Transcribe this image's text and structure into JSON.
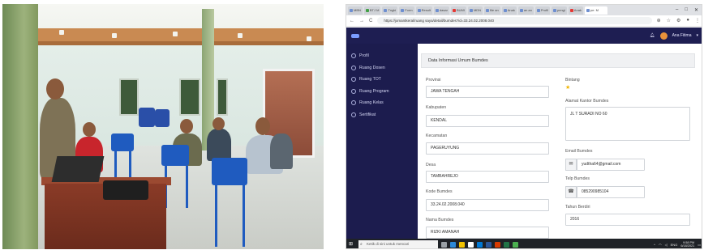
{
  "colors": {
    "navbar": "#1e1e52",
    "sidebar": "#1c1c4e",
    "star": "#f0b400",
    "taskbar": "#1f2227"
  },
  "browser": {
    "tabs": [
      "MBN",
      "BTJ M",
      "Tngki",
      "Form",
      "Result",
      "dasar",
      "BUMI",
      "MDN",
      "file an",
      "Anak",
      "an an",
      "Profil",
      "pengi",
      "Anak",
      "pe: M"
    ],
    "url": "https://jomantkeral/ruang saya/detail/bumdes?id=33.24.02.2008.040",
    "nav_back": "←",
    "nav_forward": "→",
    "nav_reload": "C",
    "win_min": "–",
    "win_max": "□",
    "win_close": "✕"
  },
  "app": {
    "user_name": "Ana Fitima",
    "sidebar": [
      {
        "label": "Profil",
        "icon": "user-icon"
      },
      {
        "label": "Ruang Dosen",
        "icon": "globe-icon"
      },
      {
        "label": "Ruang TOT",
        "icon": "globe-icon"
      },
      {
        "label": "Ruang Program",
        "icon": "globe-icon"
      },
      {
        "label": "Ruang Kelas",
        "icon": "globe-icon"
      },
      {
        "label": "Sertifikat",
        "icon": "users-icon"
      }
    ],
    "card_title": "Data Informasi Umum Bumdes",
    "fields": {
      "provinsi_label": "Provinsi",
      "provinsi_value": "JAWA TENGAH",
      "kabupaten_label": "Kabupaten",
      "kabupaten_value": "KENDAL",
      "kecamatan_label": "Kecamatan",
      "kecamatan_value": "PAGERUYUNG",
      "desa_label": "Desa",
      "desa_value": "TAMBAHREJO",
      "kode_label": "Kode Bumdes",
      "kode_value": "33.24.02.2008.040",
      "nama_label": "Nama Bumdes",
      "nama_value": "RIZKI AMANAH",
      "bintang_label": "Bintang",
      "rating_stars": 1,
      "alamat_label": "Alamat Kantor Bumdes",
      "alamat_value": "JL T SURADI NO 60",
      "email_label": "Email Bumdes",
      "email_value": "yudtha64@gmail.com",
      "telp_label": "Telp Bumdes",
      "telp_value": "085290985104",
      "tahun_label": "Tahun Berdiri",
      "tahun_value": "2016"
    }
  },
  "taskbar": {
    "search_placeholder": "Ketik di sini untuk mencari",
    "time": "9:58 PM",
    "date": "6/18/2021",
    "lang": "ENG"
  }
}
